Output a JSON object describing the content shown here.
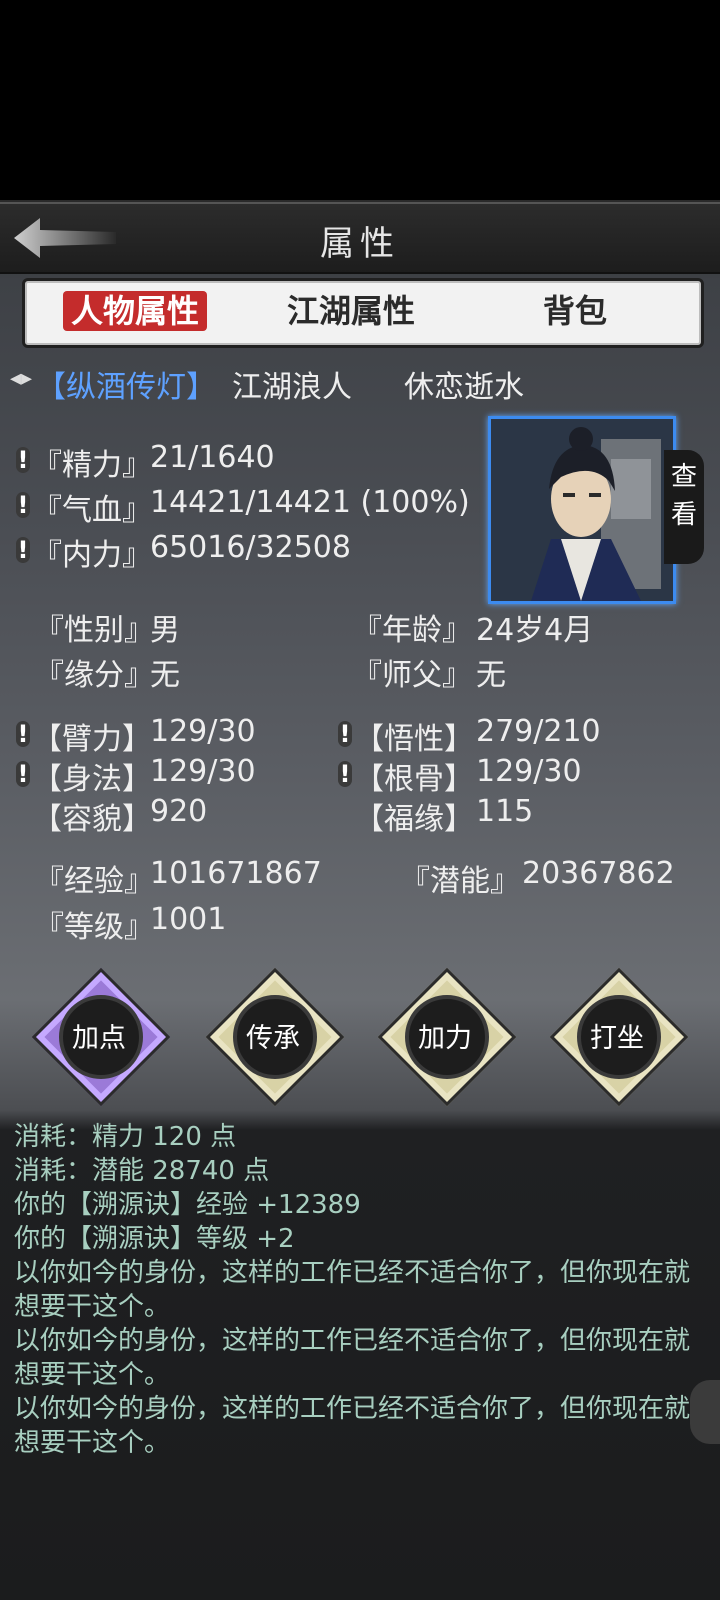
{
  "header": {
    "title": "属性"
  },
  "tabs": [
    {
      "label": "人物属性",
      "active": true
    },
    {
      "label": "江湖属性",
      "active": false
    },
    {
      "label": "背包",
      "active": false
    }
  ],
  "identity": {
    "sect": "【纵酒传灯】",
    "title": "江湖浪人",
    "name": "休恋逝水"
  },
  "vitals": [
    {
      "label": "『精力』",
      "value": "21/1640"
    },
    {
      "label": "『气血』",
      "value": "14421/14421 (100%)"
    },
    {
      "label": "『内力』",
      "value": "65016/32508"
    }
  ],
  "view_button": "查看",
  "info": {
    "gender_label": "『性别』",
    "gender": "男",
    "age_label": "『年龄』",
    "age": "24岁4月",
    "fate_label": "『缘分』",
    "fate": "无",
    "master_label": "『师父』",
    "master": "无"
  },
  "attributes": {
    "arm_label": "【臂力】",
    "arm": "129/30",
    "wisdom_label": "【悟性】",
    "wisdom": "279/210",
    "agility_label": "【身法】",
    "agility": "129/30",
    "bone_label": "【根骨】",
    "bone": "129/30",
    "looks_label": "【容貌】",
    "looks": "920",
    "luck_label": "【福缘】",
    "luck": "115"
  },
  "progress": {
    "exp_label": "『经验』",
    "exp": "101671867",
    "potential_label": "『潜能』",
    "potential": "20367862",
    "level_label": "『等级』",
    "level": "1001"
  },
  "actions": [
    {
      "label": "加点"
    },
    {
      "label": "传承"
    },
    {
      "label": "加力"
    },
    {
      "label": "打坐"
    }
  ],
  "log": [
    "消耗：精力 120 点",
    "消耗：潜能 28740 点",
    "你的【溯源诀】经验 +12389",
    "你的【溯源诀】等级 +2",
    "以你如今的身份，这样的工作已经不适合你了，但你现在就想要干这个。",
    "以你如今的身份，这样的工作已经不适合你了，但你现在就想要干这个。",
    "以你如今的身份，这样的工作已经不适合你了，但你现在就想要干这个。"
  ],
  "colors": {
    "accent_red": "#c42c2c",
    "sect_blue": "#5ea1ff",
    "log_green": "#a8cfc0"
  }
}
